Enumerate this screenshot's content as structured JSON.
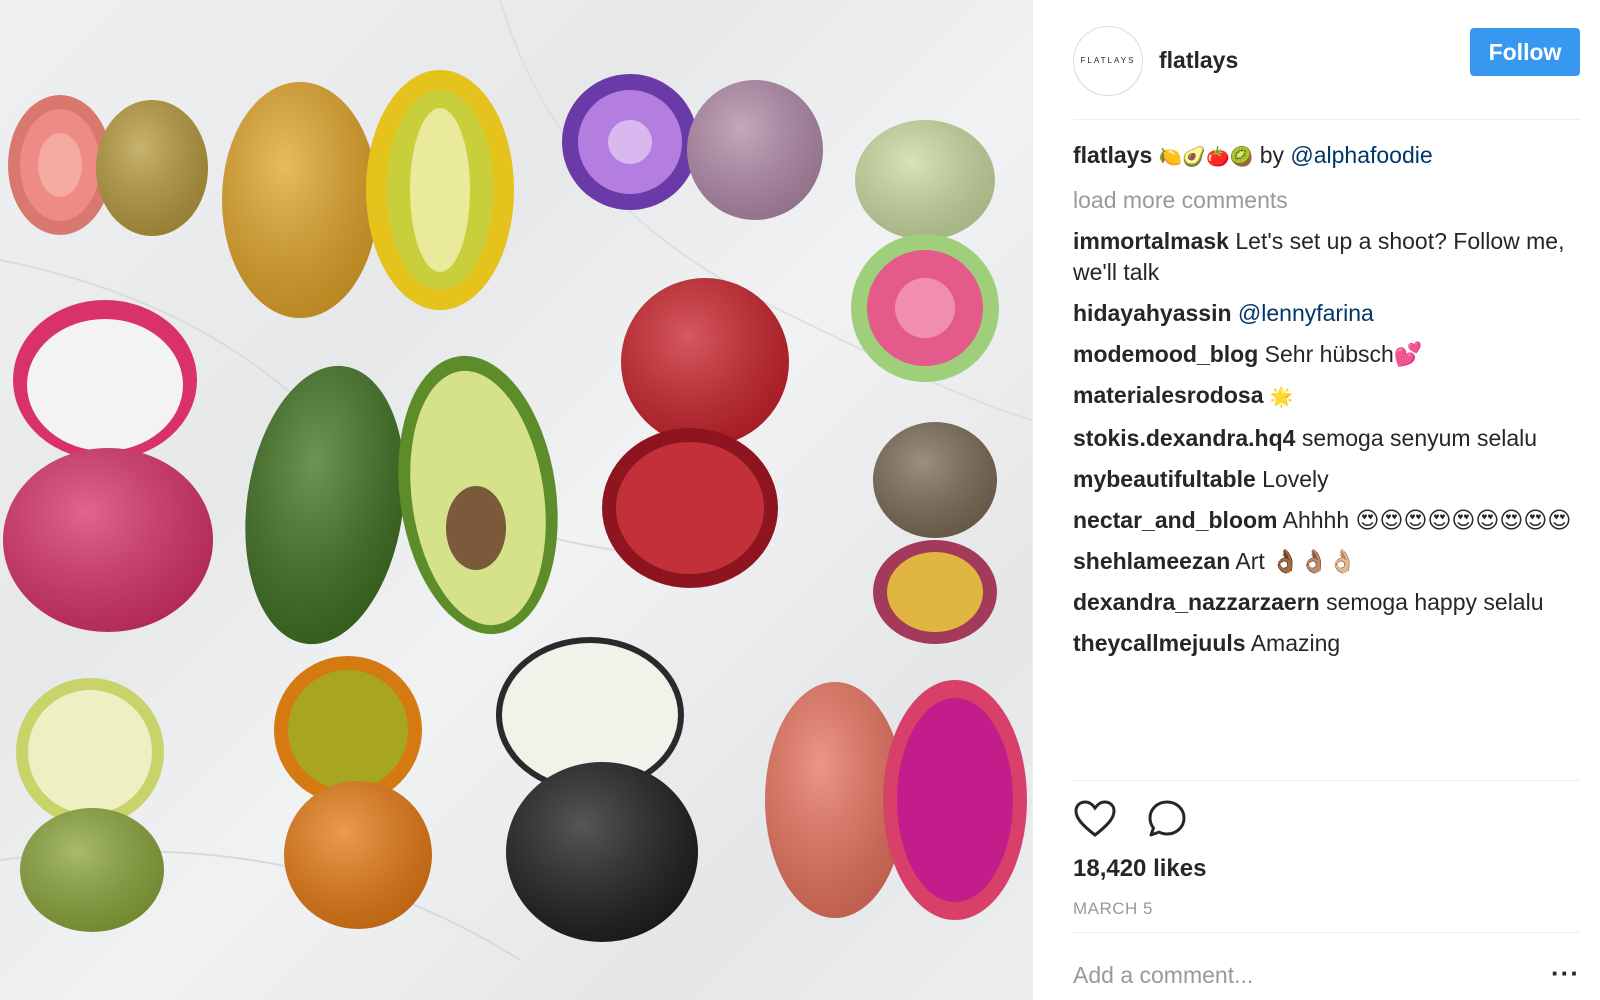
{
  "header": {
    "avatar_text": "FLATLAYS",
    "username": "flatlays",
    "follow_label": "Follow"
  },
  "caption": {
    "username": "flatlays",
    "emoji": "🍋🥑🍅🥝",
    "by_text": "by",
    "mention": "@alphafoodie"
  },
  "load_more_label": "load more comments",
  "comments": [
    {
      "username": "immortalmask",
      "text": "Let's set up a shoot? Follow me, we'll talk"
    },
    {
      "username": "hidayahyassin",
      "mention": "@lennyfarina"
    },
    {
      "username": "modemood_blog",
      "text": "Sehr hübsch💕"
    },
    {
      "username": "materialesrodosa",
      "text": "🌟"
    },
    {
      "username": "stokis.dexandra.hq4",
      "text": "semoga senyum selalu"
    },
    {
      "username": "mybeautifultable",
      "text": "Lovely"
    },
    {
      "username": "nectar_and_bloom",
      "text": "Ahhhh 😍😍😍😍😍😍😍😍😍"
    },
    {
      "username": "shehlameezan",
      "text": "Art 👌🏾👌🏽👌🏼"
    },
    {
      "username": "dexandra_nazzarzaern",
      "text": "semoga happy selalu"
    },
    {
      "username": "theycallmejuuls",
      "text": "Amazing"
    }
  ],
  "actions": {
    "like_icon": "heart-icon",
    "comment_icon": "comment-bubble-icon"
  },
  "likes": "18,420 likes",
  "date": "MARCH 5",
  "add_comment": {
    "placeholder": "Add a comment...",
    "more_label": "···"
  },
  "photo": {
    "description_icon": "fruit-flatlay-photo"
  }
}
